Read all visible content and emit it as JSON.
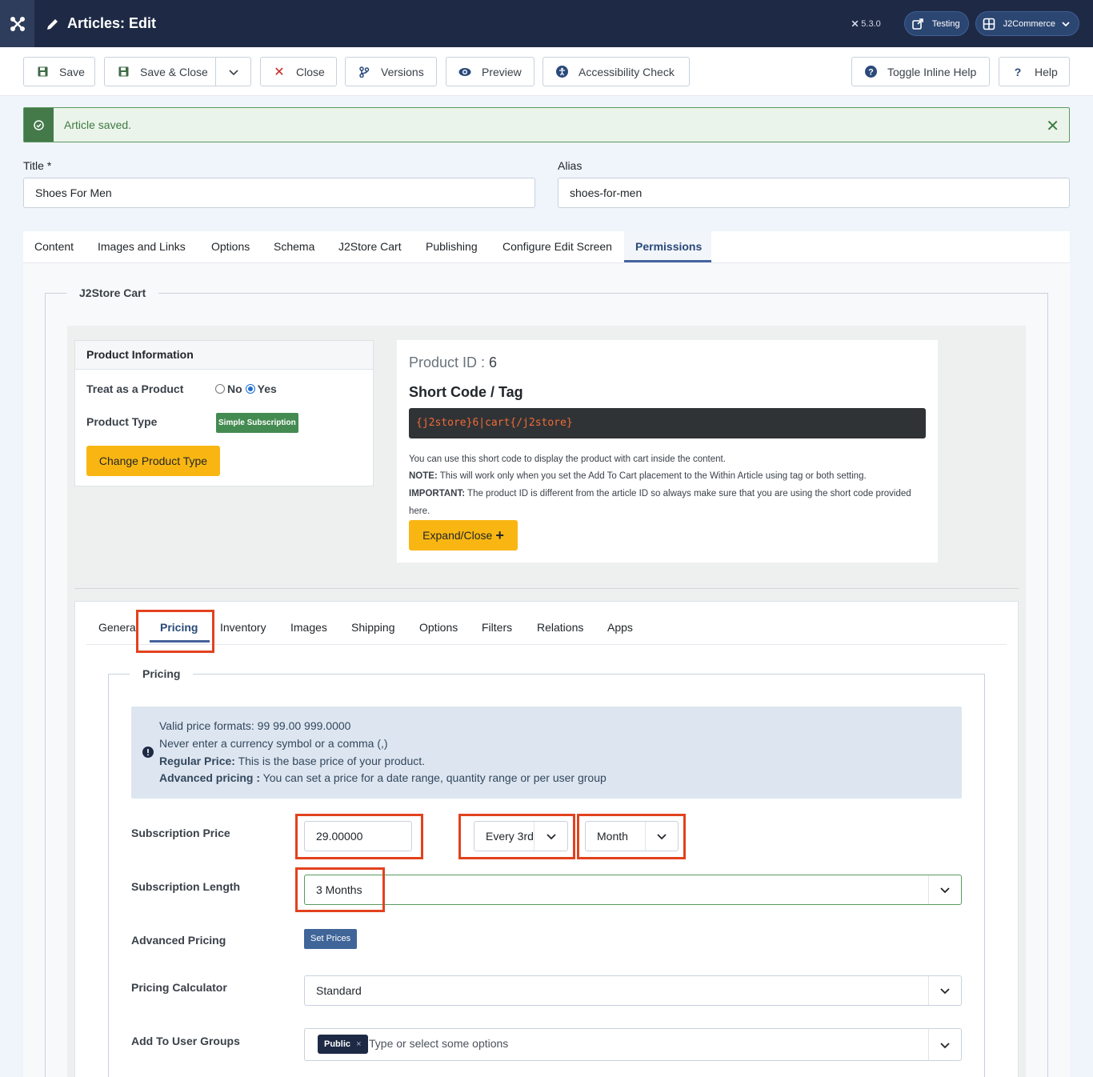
{
  "header": {
    "title": "Articles: Edit",
    "version": "5.3.0",
    "site_label": "Testing",
    "user_label": "J2Commerce"
  },
  "toolbar": {
    "save": "Save",
    "save_close": "Save & Close",
    "close": "Close",
    "versions": "Versions",
    "preview": "Preview",
    "accessibility": "Accessibility Check",
    "toggle_help": "Toggle Inline Help",
    "help": "Help"
  },
  "alert": {
    "message": "Article saved."
  },
  "form": {
    "title_label": "Title *",
    "title_value": "Shoes For Men",
    "alias_label": "Alias",
    "alias_value": "shoes-for-men"
  },
  "tabs": [
    "Content",
    "Images and Links",
    "Options",
    "Schema",
    "J2Store Cart",
    "Publishing",
    "Configure Edit Screen",
    "Permissions"
  ],
  "j2store": {
    "legend": "J2Store Cart",
    "product_info": {
      "heading": "Product Information",
      "treat_label": "Treat as a Product",
      "no": "No",
      "yes": "Yes",
      "type_label": "Product Type",
      "type_badge": "Simple Subscription",
      "change_btn": "Change Product Type"
    },
    "shortcode": {
      "product_id": "Product ID : ",
      "product_id_num": "6",
      "heading": "Short Code / Tag",
      "code": "{j2store}6|cart{/j2store}",
      "line1": "You can use this short code to display the product with cart inside the content.",
      "note_label": "NOTE:",
      "note": " This will work only when you set the Add To Cart placement to the Within Article using tag or both setting.",
      "important_label": "IMPORTANT:",
      "important": " The product ID is different from the article ID so always make sure that you are using the short code provided",
      "important_cont": "here.",
      "expand_btn": "Expand/Close"
    },
    "subtabs": [
      "General",
      "Pricing",
      "Inventory",
      "Images",
      "Shipping",
      "Options",
      "Filters",
      "Relations",
      "Apps"
    ],
    "pricing": {
      "legend": "Pricing",
      "info1": "Valid price formats: 99 99.00 999.0000",
      "info2": "Never enter a currency symbol or a comma (,)",
      "info3_label": "Regular Price:",
      "info3": " This is the base price of your product.",
      "info4_label": "Advanced pricing :",
      "info4": " You can set a price for a date range, quantity range or per user group",
      "sub_price_label": "Subscription Price",
      "sub_price_value": "29.00000",
      "every_value": "Every 3rd",
      "period_value": "Month",
      "sub_length_label": "Subscription Length",
      "sub_length_value": "3 Months",
      "adv_label": "Advanced Pricing",
      "set_prices": "Set Prices",
      "calc_label": "Pricing Calculator",
      "calc_value": "Standard",
      "groups_label": "Add To User Groups",
      "groups_chip": "Public",
      "groups_chip_x": "×",
      "groups_placeholder": "Type or select some options"
    }
  }
}
